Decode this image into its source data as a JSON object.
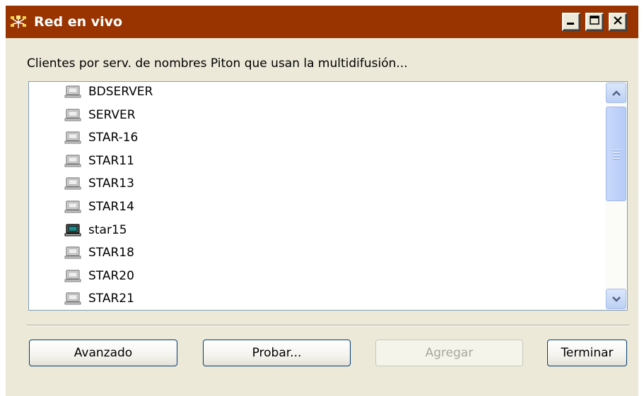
{
  "window": {
    "title": "Red en vivo",
    "controls": {
      "minimize_glyph": "_",
      "maximize_glyph": "□",
      "close_glyph": "✕"
    }
  },
  "subtitle": "Clientes por serv. de nombres Piton que usan la multidifusión...",
  "list": {
    "items": [
      {
        "name": "BDSERVER",
        "icon": "computer-gray-icon"
      },
      {
        "name": "SERVER",
        "icon": "computer-gray-icon"
      },
      {
        "name": "STAR-16",
        "icon": "computer-gray-icon"
      },
      {
        "name": "STAR11",
        "icon": "computer-gray-icon"
      },
      {
        "name": "STAR13",
        "icon": "computer-gray-icon"
      },
      {
        "name": "STAR14",
        "icon": "computer-gray-icon"
      },
      {
        "name": "star15",
        "icon": "computer-active-icon"
      },
      {
        "name": "STAR18",
        "icon": "computer-gray-icon"
      },
      {
        "name": "STAR20",
        "icon": "computer-gray-icon"
      },
      {
        "name": "STAR21",
        "icon": "computer-gray-icon"
      }
    ]
  },
  "buttons": {
    "avanzado": {
      "label": "Avanzado",
      "enabled": true
    },
    "probar": {
      "label": "Probar...",
      "enabled": true
    },
    "agregar": {
      "label": "Agregar",
      "enabled": false
    },
    "terminar": {
      "label": "Terminar",
      "enabled": true
    }
  },
  "colors": {
    "titlebar": "#993300",
    "window_bg": "#ece9d8",
    "list_border": "#7f9db9",
    "button_border": "#003c74",
    "scrollbar_thumb": "#c1d3fb"
  }
}
